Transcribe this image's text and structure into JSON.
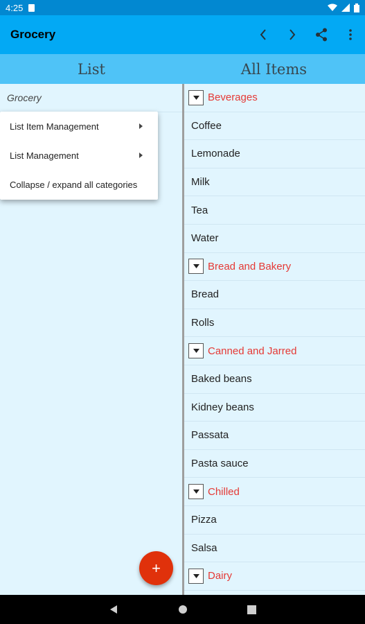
{
  "status_bar": {
    "time": "4:25"
  },
  "app_bar": {
    "title": "Grocery"
  },
  "headers": {
    "list": "List",
    "all_items": "All Items"
  },
  "lists": [
    {
      "name": "Grocery"
    }
  ],
  "menu": {
    "items": [
      {
        "label": "List Item Management",
        "has_submenu": true
      },
      {
        "label": "List Management",
        "has_submenu": true
      },
      {
        "label": "Collapse / expand all categories",
        "has_submenu": false
      }
    ]
  },
  "all_items": [
    {
      "type": "category",
      "label": "Beverages"
    },
    {
      "type": "item",
      "label": "Coffee"
    },
    {
      "type": "item",
      "label": "Lemonade"
    },
    {
      "type": "item",
      "label": "Milk"
    },
    {
      "type": "item",
      "label": "Tea"
    },
    {
      "type": "item",
      "label": "Water"
    },
    {
      "type": "category",
      "label": "Bread and Bakery"
    },
    {
      "type": "item",
      "label": "Bread"
    },
    {
      "type": "item",
      "label": "Rolls"
    },
    {
      "type": "category",
      "label": "Canned and Jarred"
    },
    {
      "type": "item",
      "label": "Baked beans"
    },
    {
      "type": "item",
      "label": "Kidney beans"
    },
    {
      "type": "item",
      "label": "Passata"
    },
    {
      "type": "item",
      "label": "Pasta sauce"
    },
    {
      "type": "category",
      "label": "Chilled"
    },
    {
      "type": "item",
      "label": "Pizza"
    },
    {
      "type": "item",
      "label": "Salsa"
    },
    {
      "type": "category",
      "label": "Dairy"
    }
  ],
  "fab": {
    "icon": "plus-icon",
    "symbol": "+"
  },
  "colors": {
    "status_bar": "#0288d1",
    "app_bar": "#03a9f4",
    "header_bar": "#4fc3f7",
    "pane_bg": "#e1f5fe",
    "category_text": "#e53935",
    "fab": "#e0310b"
  }
}
